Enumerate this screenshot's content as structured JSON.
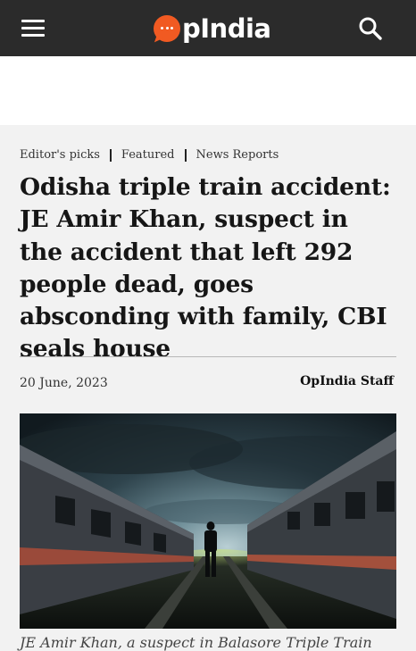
{
  "header": {
    "logo_text": "pIndia",
    "logo_alt": "OpIndia",
    "menu_icon": "hamburger-menu-icon",
    "search_icon": "search-icon",
    "bar_color": "#2b2b2b",
    "brand_color": "#f15a22"
  },
  "article": {
    "categories": [
      "Editor's picks",
      "Featured",
      "News Reports"
    ],
    "title": "Odisha triple train accident: JE Amir Khan, suspect in the accident that left 292 people dead, goes absconding with family, CBI seals house",
    "date": "20 June, 2023",
    "author": "OpIndia Staff",
    "caption": "JE Amir Khan, a suspect in Balasore Triple Train"
  }
}
